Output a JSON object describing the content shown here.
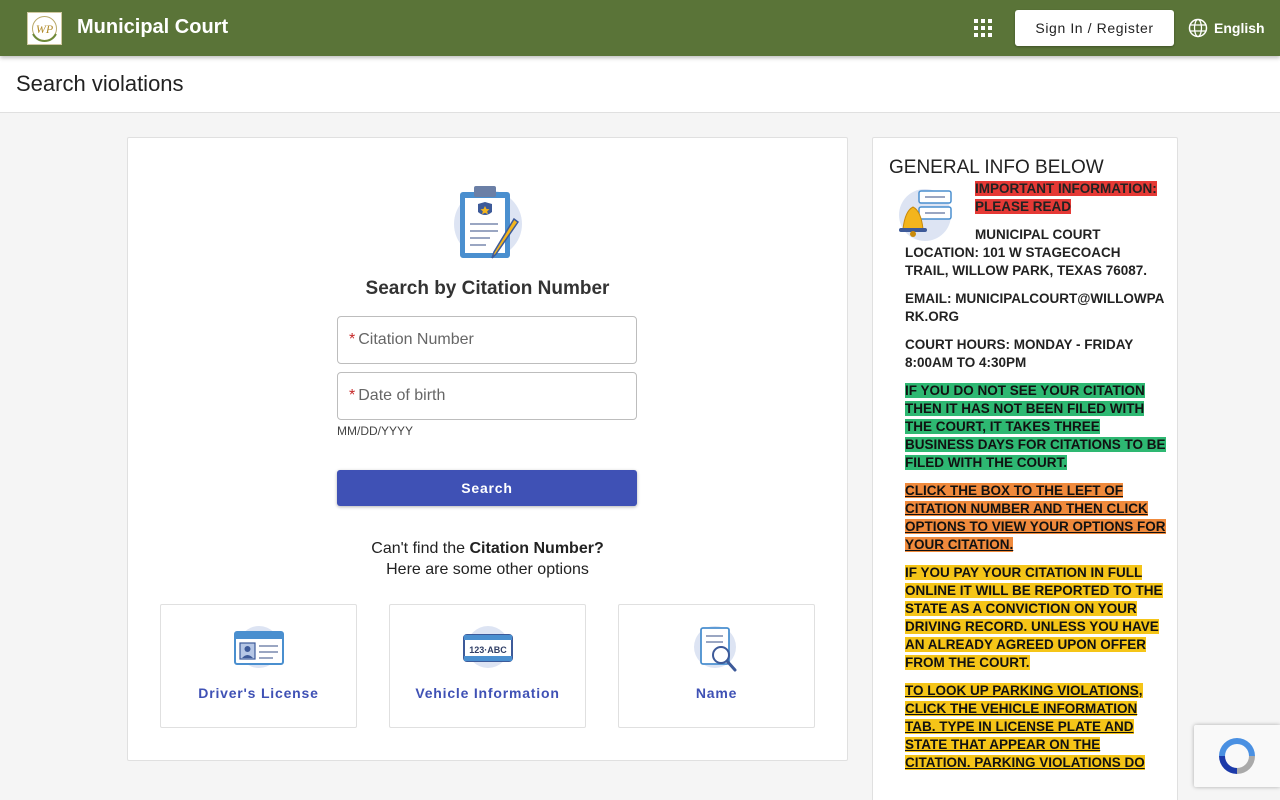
{
  "header": {
    "title": "Municipal Court",
    "logo_text": "WP",
    "signin_label": "Sign In / Register",
    "language_label": "English"
  },
  "page": {
    "title": "Search violations"
  },
  "search": {
    "heading": "Search by Citation Number",
    "citation_placeholder": "Citation Number",
    "dob_placeholder": "Date of birth",
    "required_mark": "*",
    "dob_hint": "MM/DD/YYYY",
    "search_label": "Search",
    "alt_prefix": "Can't find the ",
    "alt_bold": "Citation Number?",
    "alt_line2": "Here are some other options",
    "options": [
      {
        "label": "Driver's License",
        "icon": "drivers-license-icon"
      },
      {
        "label": "Vehicle Information",
        "icon": "vehicle-plate-icon",
        "plate_text": "123·ABC"
      },
      {
        "label": "Name",
        "icon": "name-search-icon"
      }
    ]
  },
  "info": {
    "heading": "GENERAL INFO BELOW",
    "important": "IMPORTANT INFORMATION: PLEASE READ",
    "location_line1": "MUNICIPAL COURT",
    "location_line2": "LOCATION: 101 W STAGECOACH TRAIL, WILLOW PARK, TEXAS 76087.",
    "email": "EMAIL: MUNICIPALCOURT@WILLOWPARK.ORG",
    "hours": "COURT HOURS: MONDAY - FRIDAY 8:00AM TO 4:30PM",
    "green_note": "IF YOU DO NOT SEE YOUR CITATION THEN IT HAS NOT BEEN FILED WITH THE COURT, IT TAKES THREE BUSINESS DAYS FOR CITATIONS TO BE FILED WITH THE COURT.",
    "orange_note": "CLICK THE BOX TO THE LEFT OF CITATION NUMBER AND THEN CLICK OPTIONS TO VIEW YOUR OPTIONS FOR YOUR CITATION.",
    "yellow_note": "IF YOU PAY YOUR CITATION IN FULL ONLINE IT WILL BE REPORTED TO THE STATE AS A CONVICTION ON YOUR DRIVING RECORD. UNLESS YOU HAVE AN ALREADY AGREED UPON OFFER FROM THE COURT.",
    "parking_note": "TO LOOK UP PARKING VIOLATIONS, CLICK THE VEHICLE INFORMATION TAB.  TYPE IN LICENSE PLATE AND STATE THAT APPEAR ON THE CITATION. PARKING VIOLATIONS DO"
  },
  "colors": {
    "header_bg": "#5a7438",
    "primary": "#3f51b5",
    "highlight_red": "#e53935",
    "highlight_green": "#2eb872",
    "highlight_orange": "#f08a3c",
    "highlight_yellow": "#f5c518"
  }
}
